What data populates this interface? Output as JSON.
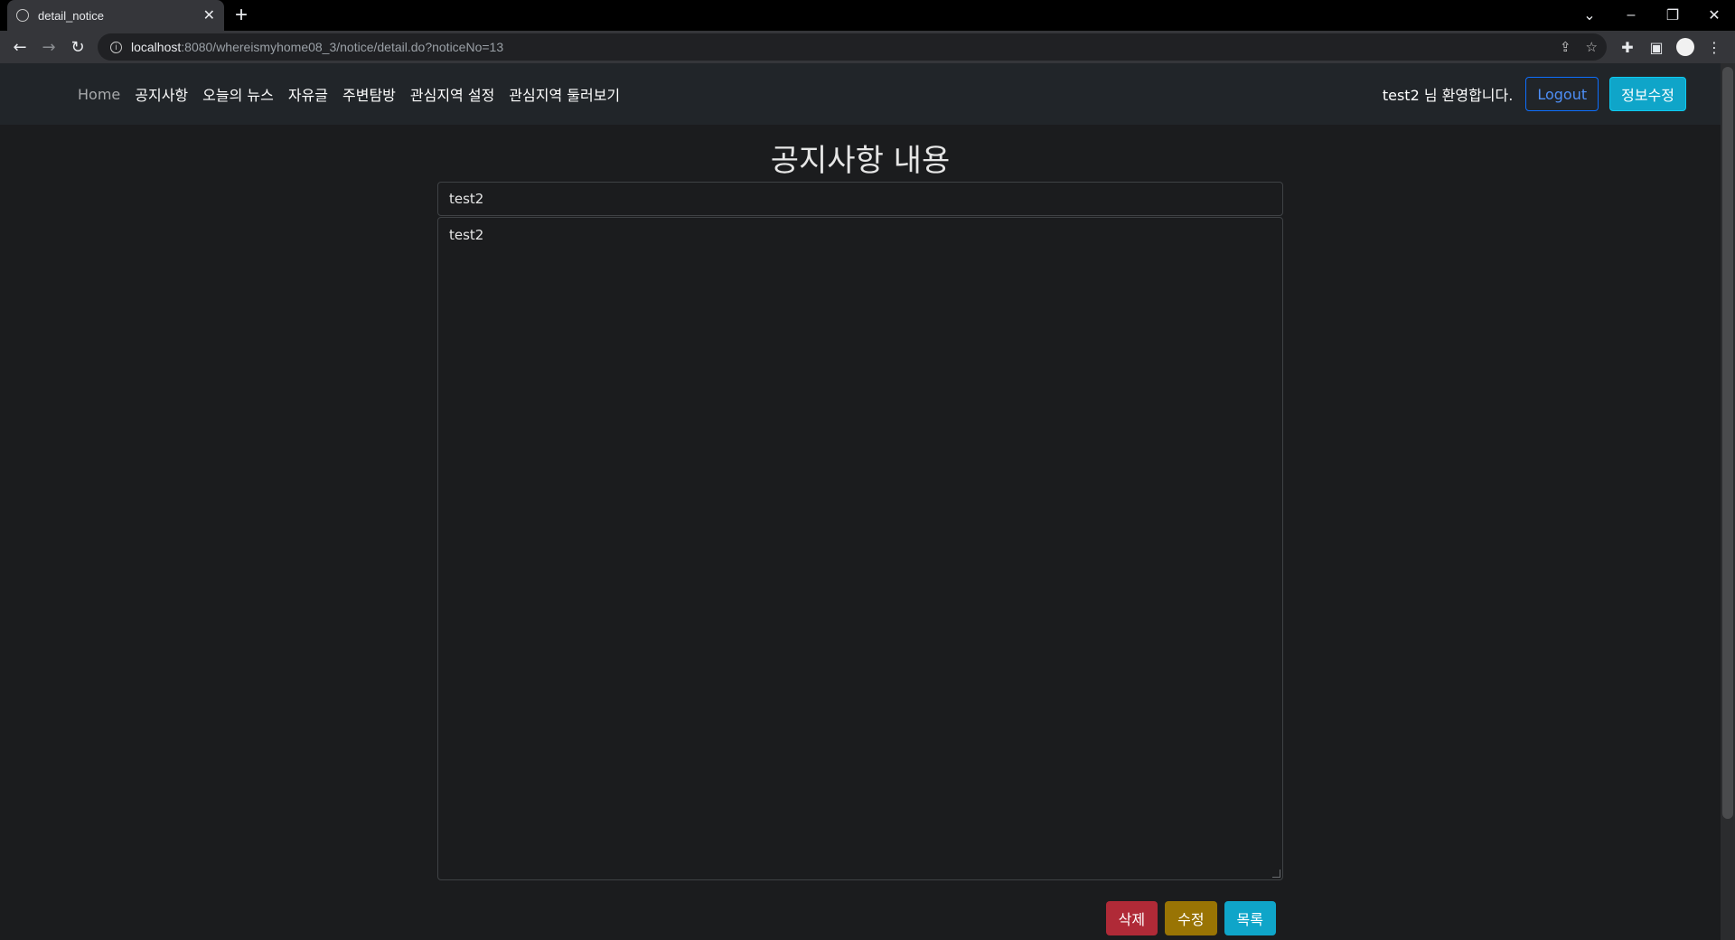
{
  "browser": {
    "tab_title": "detail_notice",
    "url_host": "localhost",
    "url_rest": ":8080/whereismyhome08_3/notice/detail.do?noticeNo=13"
  },
  "navbar": {
    "links": [
      "Home",
      "공지사항",
      "오늘의 뉴스",
      "자유글",
      "주변탐방",
      "관심지역 설정",
      "관심지역 둘러보기"
    ],
    "welcome": "test2 님 환영합니다.",
    "logout_label": "Logout",
    "edit_info_label": "정보수정"
  },
  "main": {
    "heading": "공지사항 내용",
    "title_value": "test2",
    "content_value": "test2"
  },
  "actions": {
    "delete_label": "삭제",
    "modify_label": "수정",
    "list_label": "목록"
  },
  "colors": {
    "background": "#1b1c1e",
    "navbar": "#212529",
    "delete": "#b02a37",
    "modify": "#997404",
    "list": "#0fa5c9",
    "logout_border": "#0d6efd"
  }
}
